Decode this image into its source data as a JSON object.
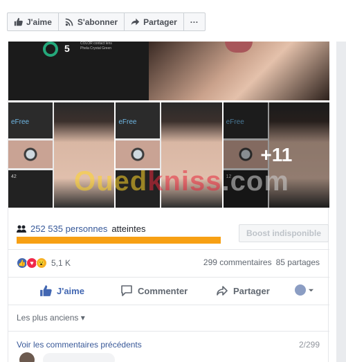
{
  "page_actions": [
    {
      "label": "J'aime",
      "icon": "thumbs-up-icon"
    },
    {
      "label": "S'abonner",
      "icon": "rss-icon"
    },
    {
      "label": "Partager",
      "icon": "share-arrow-icon"
    },
    {
      "label": "···",
      "icon": "more-icon"
    }
  ],
  "photos": {
    "banner_number": "5",
    "banner_caption": "COLOR contact lens",
    "banner_caption_2": "Phela Crystal Green",
    "tile_brand": "eFree",
    "tile_numbers": [
      "42",
      "",
      "12"
    ],
    "tile_subcaption": "COLOR contact lens",
    "more_count": "+11",
    "watermark_main": "Oued",
    "watermark_accent": "kniss",
    "watermark_tail": ".com"
  },
  "reach": {
    "count": "252 535 personnes",
    "suffix": "atteintes",
    "progress": 1.0,
    "boost_label": "Boost indisponible"
  },
  "reactions": {
    "types": [
      "like",
      "love",
      "wow"
    ],
    "total": "5,1 K",
    "comments": "299 commentaires",
    "shares": "85 partages"
  },
  "actions": {
    "like": "J'aime",
    "comment": "Commenter",
    "share": "Partager"
  },
  "comments": {
    "sort_label": "Les plus anciens ▾",
    "previous_label": "Voir les commentaires précédents",
    "counter": "2/299"
  },
  "colors": {
    "brand_blue": "#4267b2",
    "progress_orange": "#f7a014",
    "link_blue": "#365899"
  }
}
